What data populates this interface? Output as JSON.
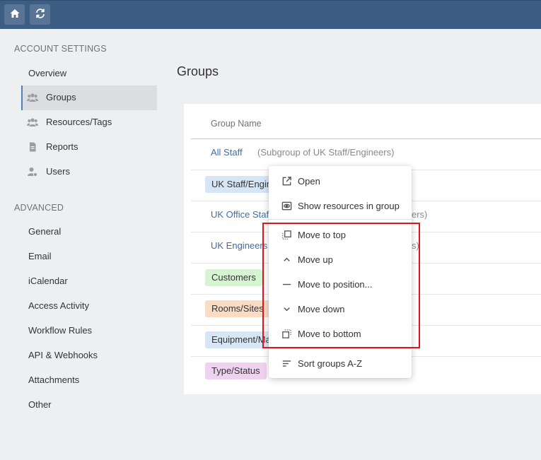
{
  "topbar": {
    "home_icon": "home-icon",
    "refresh_icon": "refresh-icon",
    "bg_color": "#3c5e84"
  },
  "sidebar": {
    "account_heading": "ACCOUNT SETTINGS",
    "account_items": [
      {
        "label": "Overview",
        "icon": null
      },
      {
        "label": "Groups",
        "icon": "users-icon",
        "active": true
      },
      {
        "label": "Resources/Tags",
        "icon": "users-icon"
      },
      {
        "label": "Reports",
        "icon": "document-icon"
      },
      {
        "label": "Users",
        "icon": "user-gear-icon"
      }
    ],
    "advanced_heading": "ADVANCED",
    "advanced_items": [
      {
        "label": "General"
      },
      {
        "label": "Email"
      },
      {
        "label": "iCalendar"
      },
      {
        "label": "Access Activity"
      },
      {
        "label": "Workflow Rules"
      },
      {
        "label": "API & Webhooks"
      },
      {
        "label": "Attachments"
      },
      {
        "label": "Other"
      }
    ]
  },
  "main": {
    "title": "Groups",
    "column_header": "Group Name",
    "rows": [
      {
        "name": "All Staff",
        "sub": "(Subgroup of UK Staff/Engineers)",
        "style": "link"
      },
      {
        "name": "UK Staff/Engineers",
        "style": "chip",
        "color": "#d6e6f7"
      },
      {
        "name": "UK Office Staff",
        "sub_tail": "ers)",
        "style": "link"
      },
      {
        "name": "UK Engineers",
        "sub_tail": "s)",
        "style": "link"
      },
      {
        "name": "Customers",
        "style": "chip",
        "color": "#d7f4d2"
      },
      {
        "name": "Rooms/Sites",
        "style": "chip",
        "color": "#f9dcc3"
      },
      {
        "name": "Equipment/Machines",
        "style": "chip",
        "color": "#d6e6f7"
      },
      {
        "name": "Type/Status",
        "style": "chip",
        "color": "#efd2f0"
      }
    ]
  },
  "context_menu": {
    "items": [
      {
        "label": "Open",
        "icon": "open-external-icon"
      },
      {
        "label": "Show resources in group",
        "icon": "eye-icon"
      },
      {
        "label": "Move to top",
        "icon": "move-top-icon"
      },
      {
        "label": "Move up",
        "icon": "chevron-up-icon"
      },
      {
        "label": "Move to position...",
        "icon": "dash-icon"
      },
      {
        "label": "Move down",
        "icon": "chevron-down-icon"
      },
      {
        "label": "Move to bottom",
        "icon": "move-bottom-icon"
      },
      {
        "label": "Sort groups A-Z",
        "icon": "sort-icon"
      }
    ],
    "highlight_color": "#e0141e"
  }
}
